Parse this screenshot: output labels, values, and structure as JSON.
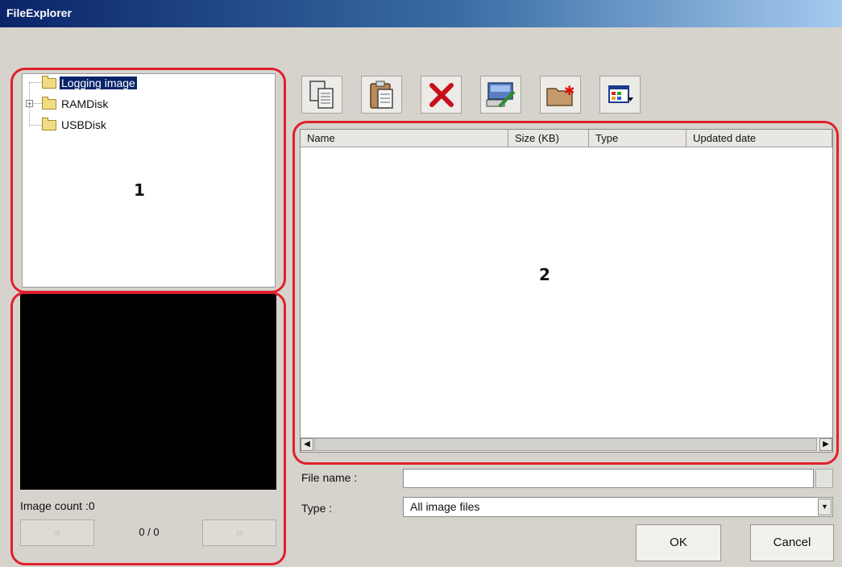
{
  "window": {
    "title": "FileExplorer"
  },
  "tree": {
    "items": [
      {
        "label": "Logging image",
        "selected": true
      },
      {
        "label": "RAMDisk",
        "expandable": true
      },
      {
        "label": "USBDisk"
      }
    ]
  },
  "callouts": {
    "left": "1",
    "right": "2"
  },
  "preview": {
    "image_count_label": "Image count :0",
    "prev_label": "«",
    "next_label": "»",
    "page_indicator": "0 / 0"
  },
  "toolbar": {
    "buttons": [
      {
        "icon": "copy-icon"
      },
      {
        "icon": "paste-icon"
      },
      {
        "icon": "delete-icon"
      },
      {
        "icon": "rename-icon"
      },
      {
        "icon": "new-folder-icon"
      },
      {
        "icon": "view-options-icon"
      }
    ]
  },
  "file_list": {
    "columns": [
      "Name",
      "Size (KB)",
      "Type",
      "Updated date"
    ],
    "rows": []
  },
  "form": {
    "file_name_label": "File name :",
    "file_name_value": "",
    "type_label": "Type :",
    "type_value": "All image files"
  },
  "buttons": {
    "ok": "OK",
    "cancel": "Cancel"
  },
  "colors": {
    "highlight_frame": "#e0202b",
    "selection": "#0a246a"
  }
}
